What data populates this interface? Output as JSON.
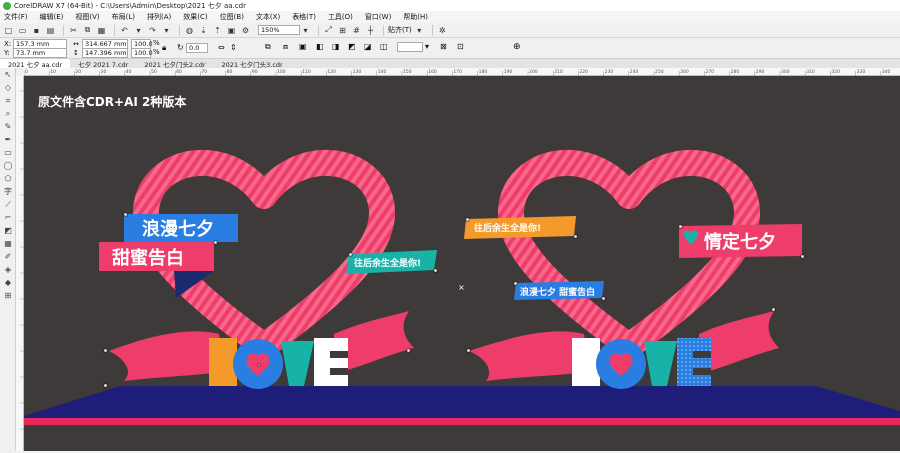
{
  "window": {
    "title": "CorelDRAW X7 (64-Bit) - C:\\Users\\Admin\\Desktop\\2021 七夕 aa.cdr"
  },
  "menu": [
    "文件(F)",
    "编辑(E)",
    "视图(V)",
    "布局(L)",
    "排列(A)",
    "效果(C)",
    "位图(B)",
    "文本(X)",
    "表格(T)",
    "工具(O)",
    "窗口(W)",
    "帮助(H)"
  ],
  "toolbar": {
    "zoom": "150%",
    "snap": "贴齐(T)"
  },
  "property_bar": {
    "x": "157.3 mm",
    "y": "73.7 mm",
    "width": "314.667 mm",
    "height": "147.396 mm",
    "scale_x": "100.0",
    "scale_y": "100.0",
    "scale_unit": "%",
    "rotation": "0.0"
  },
  "tabs": [
    "2021 七夕 aa.cdr",
    "七夕 2021 7.cdr",
    "2021 七夕门头2.cdr",
    "2021 七夕门头3.cdr"
  ],
  "ruler_ticks": [
    "0",
    "10",
    "20",
    "30",
    "40",
    "50",
    "60",
    "70",
    "80",
    "90",
    "100",
    "110",
    "120",
    "130",
    "140",
    "150",
    "160",
    "170",
    "180",
    "190",
    "200",
    "210",
    "220",
    "230",
    "240",
    "250",
    "260",
    "270",
    "280",
    "290",
    "300",
    "310",
    "320",
    "330",
    "340"
  ],
  "canvas": {
    "note": "原文件含CDR+AI 2种版本",
    "left_design": {
      "banner_top": "浪漫七夕",
      "banner_bottom": "甜蜜告白",
      "tag": "往后余生全是你!",
      "love": [
        "L",
        "O",
        "V",
        "E"
      ]
    },
    "right_design": {
      "tag_top": "往后余生全是你!",
      "banner_right": "情定七夕",
      "tag_bottom": "浪漫七夕 甜蜜告白",
      "love": [
        "L",
        "O",
        "V",
        "E"
      ]
    }
  },
  "colors": {
    "heart": "#ee3d6a",
    "heart_stripe": "#f7688a",
    "floor": "#1e1e7a",
    "floor_edge": "#e8285a",
    "canvas_bg": "#3e3a39",
    "blue": "#2a7de1",
    "teal": "#18b3a8",
    "orange": "#f39a2b"
  }
}
